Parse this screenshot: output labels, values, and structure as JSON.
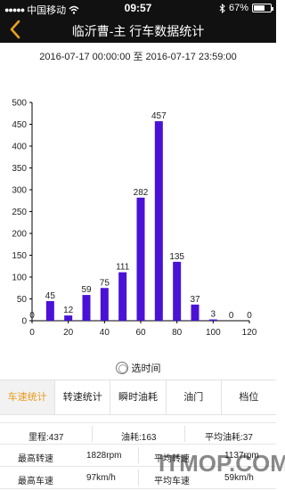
{
  "status_bar": {
    "carrier": "中国移动",
    "time": "09:57",
    "battery_percent": "67%",
    "battery_level": 0.67
  },
  "header": {
    "title": "临沂曹-主 行车数据统计"
  },
  "time_range": "2016-07-17 00:00:00 至 2016-07-17 23:59:00",
  "chart_data": {
    "type": "bar",
    "x": [
      0,
      10,
      20,
      30,
      40,
      50,
      60,
      70,
      80,
      90,
      100,
      110,
      120
    ],
    "values": [
      0,
      45,
      12,
      59,
      75,
      111,
      282,
      457,
      135,
      37,
      3,
      0,
      0
    ],
    "x_ticks": [
      0,
      20,
      40,
      60,
      80,
      100,
      120
    ],
    "y_ticks": [
      0,
      50,
      100,
      150,
      200,
      250,
      300,
      350,
      400,
      450,
      500
    ],
    "ylim": [
      0,
      500
    ],
    "bar_color": "#4a12d6"
  },
  "pick_time_label": "选时间",
  "tabs": [
    {
      "label": "车速统计",
      "active": true
    },
    {
      "label": "转速统计",
      "active": false
    },
    {
      "label": "瞬时油耗",
      "active": false
    },
    {
      "label": "油门",
      "active": false
    },
    {
      "label": "档位",
      "active": false
    }
  ],
  "stats": {
    "mileage": "里程:437",
    "fuel": "油耗:163",
    "avg_fuel": "平均油耗:37",
    "max_rpm_label": "最高转速",
    "max_rpm_value": "1828rpm",
    "avg_rpm_label": "平均转速",
    "avg_rpm_value": "1137rpm",
    "max_speed_label": "最高车速",
    "max_speed_value": "97km/h",
    "avg_speed_label": "平均车速",
    "avg_speed_value": "59km/h"
  },
  "watermark": "ITMOP.COM",
  "colors": {
    "accent": "#e89a1a",
    "header_bg": "#111111"
  }
}
